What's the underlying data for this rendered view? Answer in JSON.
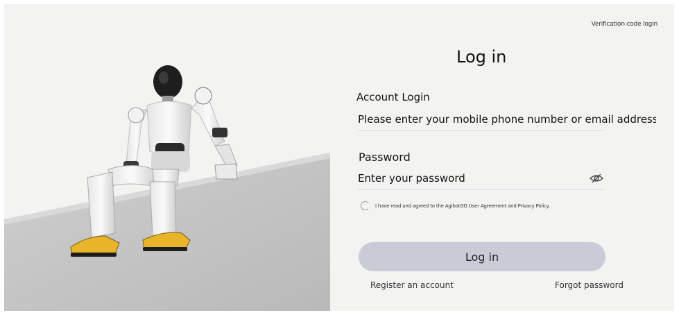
{
  "header": {
    "verification_code_login": "Verification code login",
    "title": "Log in"
  },
  "account": {
    "label": "Account Login",
    "placeholder": "Please enter your mobile phone number or email address"
  },
  "password": {
    "label": "Password",
    "placeholder": "Enter your password"
  },
  "agreement": {
    "text": "I have read and agreed to the AgibotGO User Agreement and Privacy Policy."
  },
  "actions": {
    "login_label": "Log in",
    "register_label": "Register an account",
    "forgot_label": "Forgot password"
  },
  "colors": {
    "background": "#f3f3f2",
    "button": "#c9ccd7",
    "robot_accent": "#e8b52a"
  },
  "icons": {
    "password_toggle": "eye-slash-icon"
  }
}
